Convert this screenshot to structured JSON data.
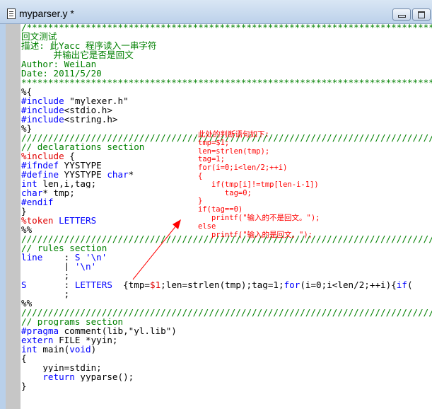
{
  "window": {
    "title": "myparser.y *",
    "minimize_label": "minimize",
    "maximize_label": "maximize"
  },
  "code_lines": [
    [
      [
        "/*****************************************************************************",
        "green"
      ]
    ],
    [
      [
        "回文测试",
        "green"
      ]
    ],
    [
      [
        "描述: 此Yacc 程序读入一串字符",
        "green"
      ]
    ],
    [
      [
        "      并输出它是否是回文",
        "green"
      ]
    ],
    [
      [
        "Author: WeiLan",
        "green"
      ]
    ],
    [
      [
        "Date: 2011/5/20",
        "green"
      ]
    ],
    [
      [
        "******************************************************************************",
        "green"
      ]
    ],
    [
      [
        "%{",
        "black"
      ]
    ],
    [
      [
        "#include",
        "blue"
      ],
      [
        " \"mylexer.h\"",
        "black"
      ]
    ],
    [
      [
        "#include",
        "blue"
      ],
      [
        "<stdio.h>",
        "black"
      ]
    ],
    [
      [
        "#include",
        "blue"
      ],
      [
        "<string.h>",
        "black"
      ]
    ],
    [
      [
        "%}",
        "black"
      ]
    ],
    [
      [
        "//////////////////////////////////////////////////////////////////////////////",
        "green"
      ]
    ],
    [
      [
        "// declarations section",
        "green"
      ]
    ],
    [
      [
        "%include",
        "red"
      ],
      [
        " {",
        "black"
      ]
    ],
    [
      [
        "#ifndef",
        "blue"
      ],
      [
        " YYSTYPE",
        "black"
      ]
    ],
    [
      [
        "#define",
        "blue"
      ],
      [
        " YYSTYPE ",
        "black"
      ],
      [
        "char",
        "blue"
      ],
      [
        "*",
        "black"
      ]
    ],
    [
      [
        "int",
        "blue"
      ],
      [
        " len,i,tag;",
        "black"
      ]
    ],
    [
      [
        "char",
        "blue"
      ],
      [
        "* tmp;",
        "black"
      ]
    ],
    [
      [
        "#endif",
        "blue"
      ]
    ],
    [
      [
        "}",
        "black"
      ]
    ],
    [
      [
        "%token",
        "red"
      ],
      [
        " LETTERS",
        "blue"
      ]
    ],
    [
      [
        "%%",
        "black"
      ]
    ],
    [
      [
        "//////////////////////////////////////////////////////////////////////////////",
        "green"
      ]
    ],
    [
      [
        "// rules section",
        "green"
      ]
    ],
    [
      [
        "line",
        "blue"
      ],
      [
        "    : ",
        "black"
      ],
      [
        "S '\\n'",
        "blue"
      ]
    ],
    [
      [
        "        | ",
        "black"
      ],
      [
        "'\\n'",
        "blue"
      ]
    ],
    [
      [
        "        ;",
        "black"
      ]
    ],
    [
      [
        "S",
        "blue"
      ],
      [
        "       : ",
        "black"
      ],
      [
        "LETTERS",
        "blue"
      ],
      [
        "  {tmp=",
        "black"
      ],
      [
        "$1",
        "red"
      ],
      [
        ";len=strlen(tmp);tag=1;",
        "black"
      ],
      [
        "for",
        "blue"
      ],
      [
        "(i=0;i<len/2;++i){",
        "black"
      ],
      [
        "if",
        "blue"
      ],
      [
        "(",
        "black"
      ]
    ],
    [
      [
        "        ;",
        "black"
      ]
    ],
    [
      [
        "%%",
        "black"
      ]
    ],
    [
      [
        "//////////////////////////////////////////////////////////////////////////////",
        "green"
      ]
    ],
    [
      [
        "// programs section",
        "green"
      ]
    ],
    [
      [
        "#pragma",
        "blue"
      ],
      [
        " comment(lib,\"yl.lib\")",
        "black"
      ]
    ],
    [
      [
        "extern",
        "blue"
      ],
      [
        " FILE *yyin;",
        "black"
      ]
    ],
    [
      [
        "int",
        "blue"
      ],
      [
        " main(",
        "black"
      ],
      [
        "void",
        "blue"
      ],
      [
        ")",
        "black"
      ]
    ],
    [
      [
        "{",
        "black"
      ]
    ],
    [
      [
        "    yyin=stdin;",
        "black"
      ]
    ],
    [
      [
        "    ",
        "black"
      ],
      [
        "return",
        "blue"
      ],
      [
        " yyparse();",
        "black"
      ]
    ],
    [
      [
        "}",
        "black"
      ]
    ]
  ],
  "annotation": {
    "lines": [
      "此处的判断语句如下:",
      "tmp=$1;",
      "len=strlen(tmp);",
      "tag=1;",
      "for(i=0;i<len/2;++i)",
      "{",
      "   if(tmp[i]!=tmp[len-i-1])",
      "      tag=0;",
      "}",
      "if(tag==0)",
      "   printf(\"输入的不是回文。\");",
      "else",
      "   printf(\"输入的是回文。\");"
    ],
    "color": "#ff0000"
  }
}
